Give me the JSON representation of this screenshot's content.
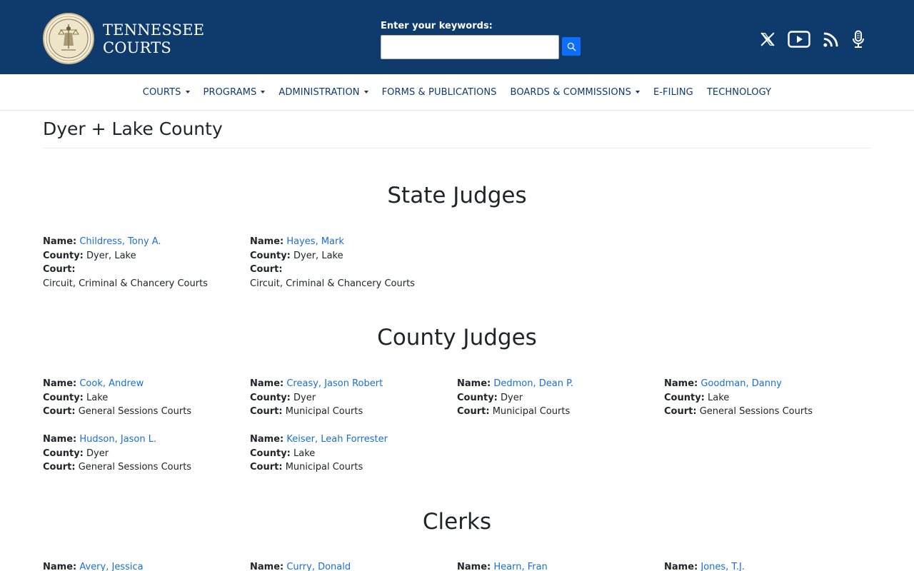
{
  "header": {
    "brand_line1": "TENNESSEE",
    "brand_line2": "COURTS",
    "seal_alt": "seal-icon",
    "search_label": "Enter your keywords:",
    "search_value": "",
    "search_placeholder": "",
    "social": [
      "x-icon",
      "youtube-icon",
      "rss-icon",
      "podcast-microphone-icon"
    ]
  },
  "nav": {
    "items": [
      {
        "label": "COURTS",
        "dropdown": true
      },
      {
        "label": "PROGRAMS",
        "dropdown": true
      },
      {
        "label": "ADMINISTRATION",
        "dropdown": true
      },
      {
        "label": "FORMS & PUBLICATIONS",
        "dropdown": false
      },
      {
        "label": "BOARDS & COMMISSIONS",
        "dropdown": true
      },
      {
        "label": "E-FILING",
        "dropdown": false
      },
      {
        "label": "TECHNOLOGY",
        "dropdown": false
      }
    ]
  },
  "page": {
    "title": "Dyer + Lake County"
  },
  "labels": {
    "name": "Name:",
    "county": "County:",
    "court": "Court:"
  },
  "sections": {
    "state_judges": {
      "heading": "State Judges",
      "people": [
        {
          "name": "Childress, Tony A.",
          "county": "Dyer, Lake",
          "court": "Circuit, Criminal & Chancery Courts"
        },
        {
          "name": "Hayes, Mark",
          "county": "Dyer, Lake",
          "court": "Circuit, Criminal & Chancery Courts"
        }
      ]
    },
    "county_judges": {
      "heading": "County Judges",
      "people": [
        {
          "name": "Cook, Andrew",
          "county": "Lake",
          "court": "General Sessions Courts"
        },
        {
          "name": "Creasy, Jason Robert",
          "county": "Dyer",
          "court": "Municipal Courts"
        },
        {
          "name": "Dedmon, Dean P.",
          "county": "Dyer",
          "court": "Municipal Courts"
        },
        {
          "name": "Goodman, Danny",
          "county": "Lake",
          "court": "General Sessions Courts"
        },
        {
          "name": "Hudson, Jason L.",
          "county": "Dyer",
          "court": "General Sessions Courts"
        },
        {
          "name": "Keiser, Leah Forrester",
          "county": "Lake",
          "court": "Municipal Courts"
        }
      ]
    },
    "clerks": {
      "heading": "Clerks",
      "people": [
        {
          "name": "Avery, Jessica"
        },
        {
          "name": "Curry, Donald"
        },
        {
          "name": "Hearn, Fran"
        },
        {
          "name": "Jones, T.J."
        }
      ]
    }
  }
}
